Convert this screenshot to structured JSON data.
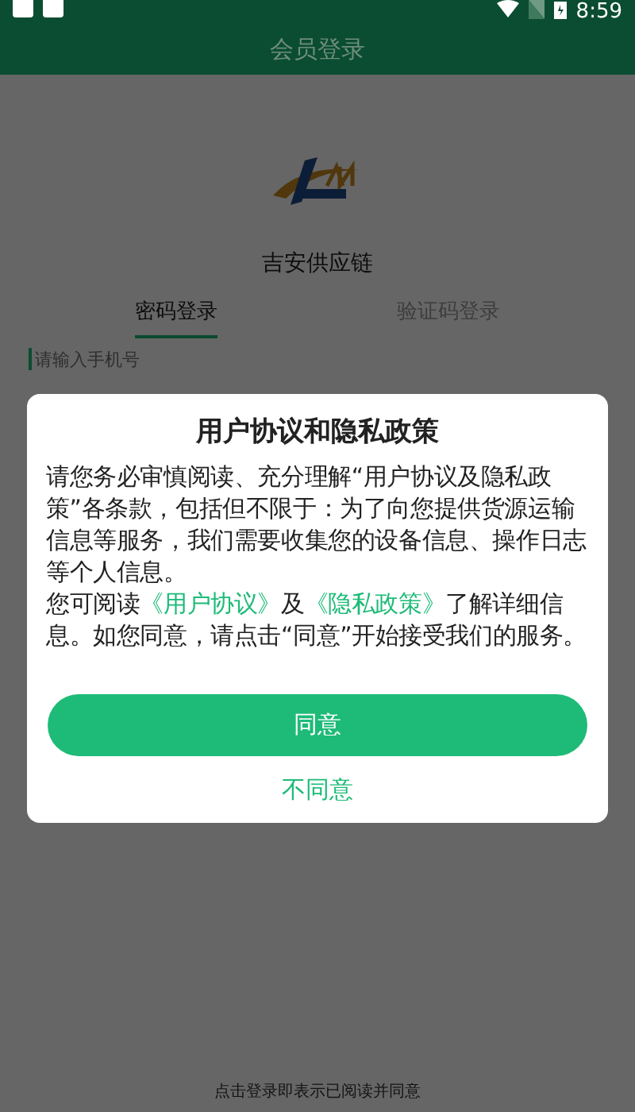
{
  "status_bar": {
    "time": "8:59"
  },
  "header": {
    "title": "会员登录"
  },
  "app_name": "吉安供应链",
  "tabs": [
    {
      "label": "密码登录",
      "selected": true
    },
    {
      "label": "验证码登录",
      "selected": false
    }
  ],
  "phone_field": {
    "placeholder": "请输入手机号"
  },
  "footer_note": "点击登录即表示已阅读并同意",
  "dialog": {
    "title": "用户协议和隐私政策",
    "paragraphs": [
      [
        {
          "kind": "text",
          "text": "请您务必审慎阅读、充分理解“用户协议及隐私政策”各条款，包括但不限于：为了向您提供货源运输信息等服务，我们需要收集您的设备信息、操作日志等个人信息。"
        }
      ],
      [
        {
          "kind": "text",
          "text": "您可阅读"
        },
        {
          "kind": "link",
          "text": "《用户协议》"
        },
        {
          "kind": "text",
          "text": "及"
        },
        {
          "kind": "link",
          "text": "《隐私政策》"
        },
        {
          "kind": "text",
          "text": "了解详细信息。如您同意，请点击“同意”开始接受我们的服务。"
        }
      ]
    ],
    "agree_button": "同意",
    "decline_link": "不同意"
  }
}
